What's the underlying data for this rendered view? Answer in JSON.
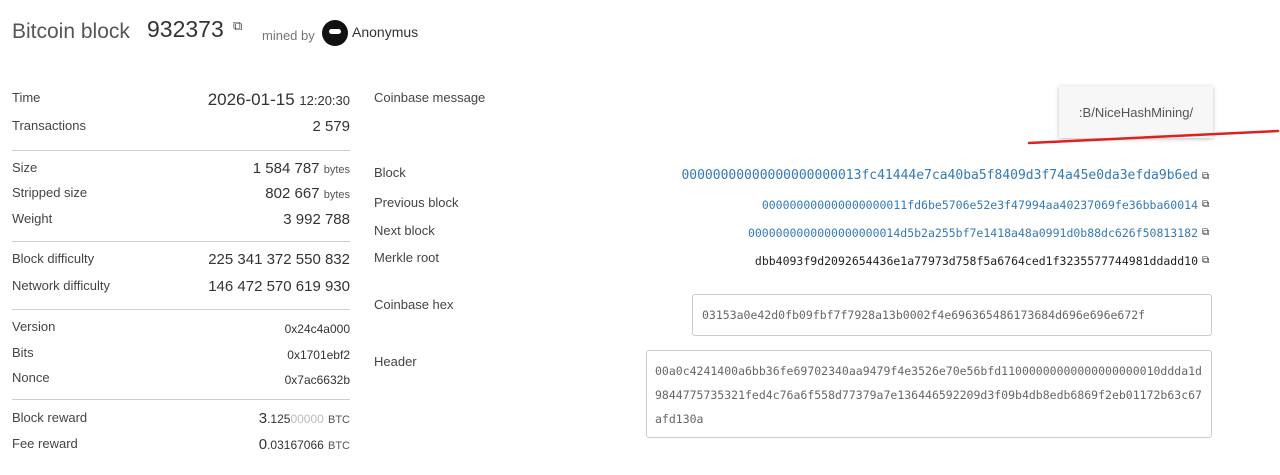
{
  "header": {
    "title": "Bitcoin block",
    "height": "932373",
    "mined_by": "mined by",
    "pool_name": "Anonymus"
  },
  "stats": {
    "time": {
      "label": "Time",
      "date": "2026-01-15",
      "clock": "12:20:30"
    },
    "transactions": {
      "label": "Transactions",
      "value": "2 579"
    },
    "size": {
      "label": "Size",
      "value": "1 584 787",
      "unit": "bytes"
    },
    "stripped_size": {
      "label": "Stripped size",
      "value": "802 667",
      "unit": "bytes"
    },
    "weight": {
      "label": "Weight",
      "value": "3 992 788"
    },
    "block_difficulty": {
      "label": "Block difficulty",
      "value": "225 341 372 550 832"
    },
    "network_difficulty": {
      "label": "Network difficulty",
      "value": "146 472 570 619 930"
    },
    "version": {
      "label": "Version",
      "value": "0x24c4a000"
    },
    "bits": {
      "label": "Bits",
      "value": "0x1701ebf2"
    },
    "nonce": {
      "label": "Nonce",
      "value": "0x7ac6632b"
    },
    "block_reward": {
      "label": "Block reward",
      "int": "3",
      "frac": ".125",
      "frac_gray": "00000",
      "unit": "BTC"
    },
    "fee_reward": {
      "label": "Fee reward",
      "int": "0",
      "frac": ".03167066",
      "unit": "BTC"
    }
  },
  "details": {
    "coinbase_message_label": "Coinbase message",
    "coinbase_message": ":B/NiceHashMining/",
    "block_label": "Block",
    "block_hash": "00000000000000000000013fc41444e7ca40ba5f8409d3f74a45e0da3efda9b6ed",
    "previous_block_label": "Previous block",
    "previous_block_hash": "000000000000000000011fd6be5706e52e3f47994aa40237069fe36bba60014",
    "next_block_label": "Next block",
    "next_block_hash": "0000000000000000000014d5b2a255bf7e1418a48a0991d0b88dc626f50813182",
    "merkle_root_label": "Merkle root",
    "merkle_root": "dbb4093f9d2092654436e1a77973d758f5a6764ced1f3235577744981ddadd10",
    "coinbase_hex_label": "Coinbase hex",
    "coinbase_hex": "03153a0e42d0fb09fbf7f7928a13b0002f4e696365486173684d696e696e672f",
    "header_label": "Header",
    "header_hex": "00a0c4241400a6bb36fe69702340aa9479f4e3526e70e56bfd11000000000000000000010ddda1d9844775735321fed4c76a6f558d77379a7e136446592209d3f09b4db8edb6869f2eb01172b63c67afd130a"
  },
  "colors": {
    "link": "#337ab7",
    "annotation": "#e02020"
  },
  "icons": {
    "copy": "copy-icon",
    "pool": "pool-logo-icon"
  }
}
